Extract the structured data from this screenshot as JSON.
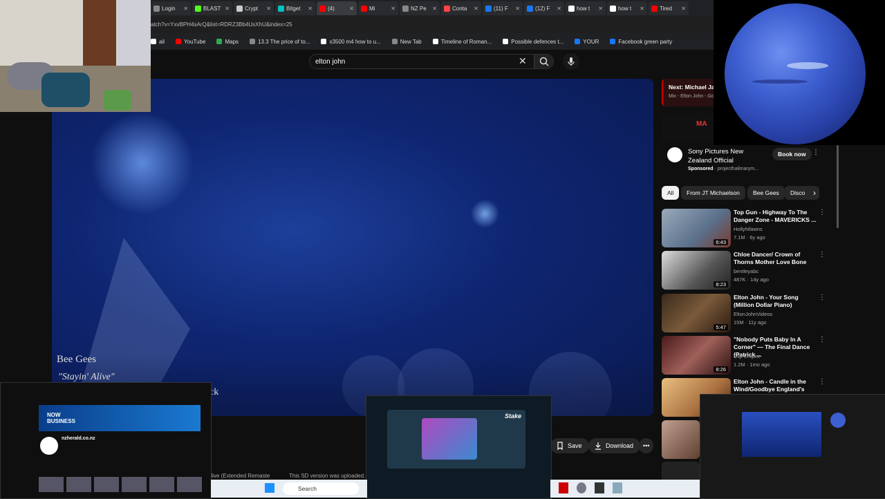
{
  "browser": {
    "tabs": [
      {
        "label": "Login",
        "color": "#888888"
      },
      {
        "label": "BLAST",
        "color": "#53fc18"
      },
      {
        "label": "Crypt",
        "color": "#cccccc"
      },
      {
        "label": "Bitget",
        "color": "#00c2c2"
      },
      {
        "label": "(4)",
        "color": "#ff0000"
      },
      {
        "label": "Mi",
        "color": "#ff0000"
      },
      {
        "label": "NZ Pe",
        "color": "#888888"
      },
      {
        "label": "Conta",
        "color": "#ff4444"
      },
      {
        "label": "(11) F",
        "color": "#1877f2"
      },
      {
        "label": "(12) F",
        "color": "#1877f2"
      },
      {
        "label": "how t",
        "color": "#ffffff"
      },
      {
        "label": "how t",
        "color": "#ffffff"
      },
      {
        "label": "Tired",
        "color": "#ff0000"
      }
    ],
    "url": "atch?v=YxvBPH4sArQ&list=RDRZ3Bb4UsXhU&index=25",
    "bookmarks": [
      {
        "label": "ail",
        "color": "#ffffff"
      },
      {
        "label": "YouTube",
        "color": "#ff0000"
      },
      {
        "label": "Maps",
        "color": "#34a853"
      },
      {
        "label": "13.3 The price of to...",
        "color": "#888888"
      },
      {
        "label": "x3500 m4 how to u...",
        "color": "#ffffff"
      },
      {
        "label": "New Tab",
        "color": "#888888"
      },
      {
        "label": "Timeline of Roman...",
        "color": "#ffffff"
      },
      {
        "label": "Possible defences t...",
        "color": "#ffffff"
      },
      {
        "label": "YOUR",
        "color": "#1877f2"
      },
      {
        "label": "Facebook green party",
        "color": "#1877f2"
      }
    ]
  },
  "youtube": {
    "search_value": "elton john",
    "video": {
      "caption_artist": "Bee Gees",
      "caption_song": "\"Stayin' Alive\"",
      "caption_partial": "ck",
      "below_fragment": "Alive (Extended Remaste",
      "below_fragment2": "This SD version was uploaded..."
    },
    "actions": {
      "save": "Save",
      "download": "Download",
      "more": "•••"
    },
    "next": {
      "label": "Next: Michael Jac",
      "sub": "Mix - Elton John - Go"
    },
    "ad": {
      "title": "Sony Pictures New Zealand Official",
      "sponsored": "Sponsored",
      "sponsor_link": "projecthailmarym...",
      "cta": "Book now"
    },
    "chips": [
      "All",
      "From JT Michaelson",
      "Bee Gees",
      "Disco"
    ],
    "recommendations": [
      {
        "title": "Top Gun - Highway To The Danger Zone - MAVERICKS ...",
        "channel": "HollyNfawns",
        "meta": "7.1M · 6y ago",
        "duration": "6:43"
      },
      {
        "title": "Chloe Dancer/ Crown of Thorns Mother Love Bone",
        "channel": "bentleyabc",
        "meta": "487K · 14y ago",
        "duration": "8:23"
      },
      {
        "title": "Elton John - Your Song (Million Dollar Piano)",
        "channel": "EltonJohnVideos",
        "meta": "15M · 11y ago",
        "duration": "5:47"
      },
      {
        "title": "\"Nobody Puts Baby In A Corner\" — The Final Dance (Patrick ...",
        "channel": "Clip Empire",
        "meta": "1.2M · 1mo ago",
        "duration": "8:26"
      },
      {
        "title": "Elton John - Candle in the Wind/Goodbye England's Rose...",
        "channel": "",
        "meta": "",
        "duration": ""
      }
    ]
  },
  "overlays": {
    "nzherald_title": "nzherald.co.nz",
    "nzherald_banner": "NOW BUSINESS",
    "stake_logo": "Stake",
    "taskbar_search": "Search"
  }
}
